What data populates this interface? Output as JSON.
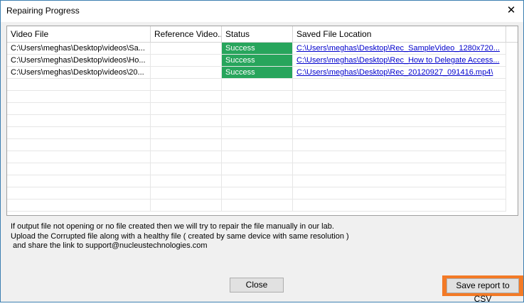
{
  "window": {
    "title": "Repairing Progress",
    "close_glyph": "✕"
  },
  "table": {
    "columns": [
      "Video File",
      "Reference Video...",
      "Status",
      "Saved File Location"
    ],
    "rows": [
      {
        "video": "C:\\Users\\meghas\\Desktop\\videos\\Sa...",
        "ref": "",
        "status": "Success",
        "location": "C:\\Users\\meghas\\Desktop\\Rec_SampleVideo_1280x720..."
      },
      {
        "video": "C:\\Users\\meghas\\Desktop\\videos\\Ho...",
        "ref": "",
        "status": "Success",
        "location": "C:\\Users\\meghas\\Desktop\\Rec_How to Delegate Access..."
      },
      {
        "video": "C:\\Users\\meghas\\Desktop\\videos\\20...",
        "ref": "",
        "status": "Success",
        "location": "C:\\Users\\meghas\\Desktop\\Rec_20120927_091416.mp4\\"
      }
    ]
  },
  "message": {
    "line1": "If output file not opening or no file created then we will try to repair the file manually in our lab.",
    "line2": "Upload the Corrupted file along with a healthy file ( created by same device with same resolution )",
    "line3": " and share the link to support@nucleustechnologies.com"
  },
  "buttons": {
    "close_label": "Close",
    "save_label": "Save report to CSV"
  },
  "colors": {
    "success": "#27a55c",
    "highlight": "#f37a26",
    "link": "#0000cc"
  }
}
